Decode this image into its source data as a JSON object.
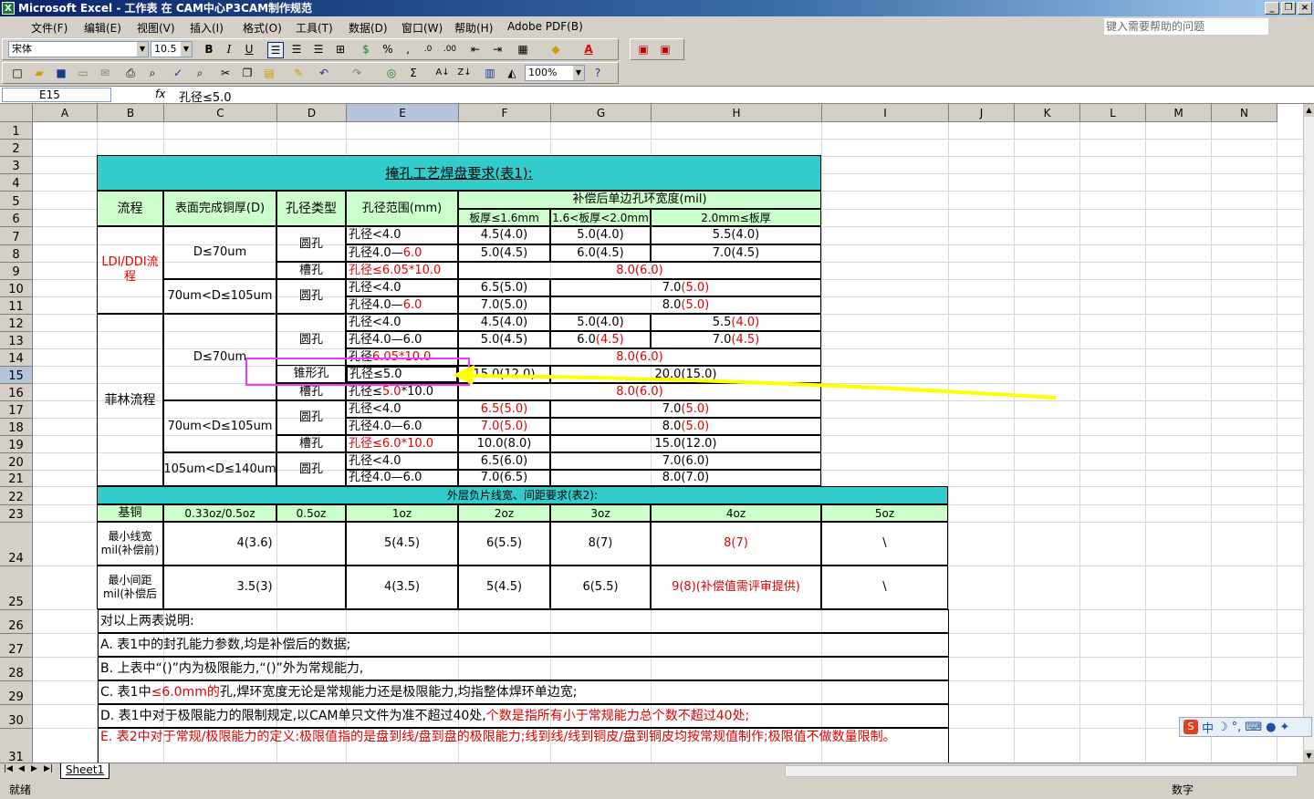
{
  "window": {
    "title": "Microsoft Excel - 工作表 在 CAM中心P3CAM制作规范",
    "app_icon": "X"
  },
  "menu": {
    "items": [
      "文件(F)",
      "编辑(E)",
      "视图(V)",
      "插入(I)",
      "格式(O)",
      "工具(T)",
      "数据(D)",
      "窗口(W)",
      "帮助(H)",
      "Adobe PDF(B)"
    ],
    "help_placeholder": "键入需要帮助的问题"
  },
  "toolbar": {
    "font_name": "宋体",
    "font_size": "10.5",
    "zoom": "100%",
    "bold": "B",
    "italic": "I",
    "underline": "U",
    "percent": "%",
    "comma": ",",
    "font_color_letter": "A"
  },
  "formula_bar": {
    "cell_ref": "E15",
    "fx": "fx",
    "formula": "孔径≤5.0"
  },
  "columns": [
    "A",
    "B",
    "C",
    "D",
    "E",
    "F",
    "G",
    "H",
    "I",
    "J",
    "K",
    "L",
    "M",
    "N"
  ],
  "rows": [
    "1",
    "2",
    "3",
    "4",
    "5",
    "6",
    "7",
    "8",
    "9",
    "10",
    "11",
    "12",
    "13",
    "14",
    "15",
    "16",
    "17",
    "18",
    "19",
    "20",
    "21",
    "22",
    "23",
    "24",
    "25",
    "26",
    "27",
    "28",
    "29",
    "30",
    "31"
  ],
  "table1": {
    "title": "掩孔工艺焊盘要求(表1):",
    "h_process": "流程",
    "h_copper": "表面完成铜厚(D)",
    "h_hole_type": "孔径类型",
    "h_hole_range": "孔径范围(mm)",
    "h_ring": "补偿后单边孔环宽度(mil)",
    "h_t1": "板厚≤1.6mm",
    "h_t2": "1.6<板厚<2.0mm",
    "h_t3": "2.0mm≤板厚",
    "ldi": "LDI/DDI流程",
    "film": "菲林流程",
    "cu_70": "D≤70um",
    "cu_70_105": "70um<D≤105um",
    "cu_105_140": "105um<D≤140um",
    "round": "圆孔",
    "slot": "槽孔",
    "cone": "锥形孔",
    "r7": [
      "孔径<4.0",
      "4.5(4.0)",
      "5.0(4.0)",
      "5.5(4.0)"
    ],
    "r8_pre": "孔径4.0—",
    "r8_red": "6.0",
    "r8": [
      "5.0(4.5)",
      "6.0(4.5)",
      "7.0(4.5)"
    ],
    "r9": [
      "孔径≤6.05*10.0",
      "8.0(6.0)"
    ],
    "r10_e": "孔径<4.0",
    "r10_f": "6.5(5.0)",
    "r10_gh_pre": "7.0",
    "r10_gh_red": "(5.0)",
    "r11_pre": "孔径4.0—",
    "r11_red": "6.0",
    "r11_f": "7.0(5.0)",
    "r11_gh_pre": "8.0",
    "r11_gh_red": "(5.0)",
    "r12_e": "孔径<4.0",
    "r12_f": "4.5(4.0)",
    "r12_g": "5.0(4.0)",
    "r12_h_pre": "5.5",
    "r12_h_red": "(4.0)",
    "r13_e": "孔径4.0—6.0",
    "r13_f": "5.0(4.5)",
    "r13_g_pre": "6.0",
    "r13_g_red": "(4.5)",
    "r13_h_pre": "7.0",
    "r13_h_red": "(4.5)",
    "r14_e_pre": "孔径",
    "r14_e_red": "6.05*10.0",
    "r14_fgh": "8.0(6.0)",
    "r15": [
      "孔径≤5.0",
      "15.0(12.0)",
      "20.0(15.0)"
    ],
    "r16_e_pre": "孔径≤",
    "r16_e_red": "5.0",
    "r16_e_post": "*10.0",
    "r16_fgh": "8.0(6.0)",
    "r17_e": "孔径<4.0",
    "r17_f": "6.5(5.0)",
    "r17_gh_pre": "7.0",
    "r17_gh_red": "(5.0)",
    "r18_e": "孔径4.0—6.0",
    "r18_f": "7.0(5.0)",
    "r18_gh_pre": "8.0",
    "r18_gh_red": "(5.0)",
    "r19": [
      "孔径≤6.0*10.0",
      "10.0(8.0)",
      "15.0(12.0)"
    ],
    "r20": [
      "孔径<4.0",
      "6.5(6.0)",
      "7.0(6.0)"
    ],
    "r21": [
      "孔径4.0—6.0",
      "7.0(6.5)",
      "8.0(7.0)"
    ]
  },
  "table2": {
    "title": "外层负片线宽、间距要求(表2):",
    "h_base": "基铜",
    "weights": [
      "0.33oz/0.5oz",
      "0.5oz",
      "1oz",
      "2oz",
      "3oz",
      "4oz",
      "5oz"
    ],
    "min_width_label": "最小线宽mil(补偿前)",
    "min_width": [
      "4(3.6)",
      "5(4.5)",
      "6(5.5)",
      "8(7)",
      "8(7)",
      "\\"
    ],
    "min_space_label": "最小间距mil(补偿后",
    "min_space": [
      "3.5(3)",
      "4(3.5)",
      "5(4.5)",
      "6(5.5)",
      "9(8)(补偿值需评审提供)",
      "\\"
    ]
  },
  "notes": {
    "n26": "对以上两表说明:",
    "n27": "A. 表1中的封孔能力参数,均是补偿后的数据;",
    "n28": "B. 上表中“()”内为极限能力,“()”外为常规能力,",
    "n29_pre": "C. 表1中",
    "n29_red": "≤6.0mm的",
    "n29_post": "孔,焊环宽度无论是常规能力还是极限能力,均指整体焊环单边宽;",
    "n30_pre": "D. 表1中对于极限能力的限制规定,以CAM单只文件为准不超过40处,",
    "n30_red": "个数是指所有小于常规能力总个数不超过40处;",
    "n31": "E. 表2中对于常规/极限能力的定义:极限值指的是盘到线/盘到盘的极限能力;线到线/线到铜皮/盘到铜皮均按常规值制作;极限值不做数量限制。"
  },
  "sheet_tab": "Sheet1",
  "status": {
    "left": "就绪",
    "right": "数字"
  },
  "ime": {
    "logo": "S",
    "lang": "中"
  },
  "colors": {
    "teal": "#33cccc",
    "light_green": "#ccffcc",
    "red_text": "#e00000",
    "highlight_box": "#ff33ff",
    "arrow": "#ffff00"
  }
}
